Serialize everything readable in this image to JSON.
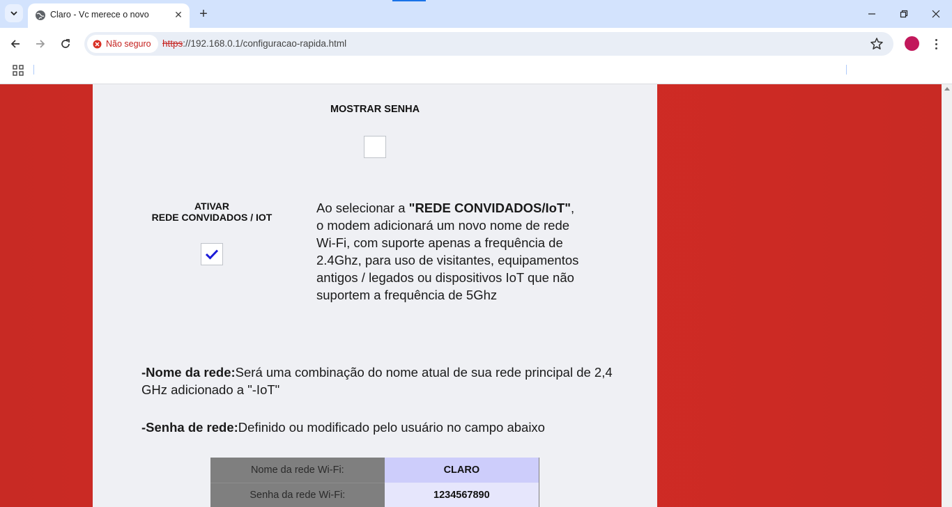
{
  "browser": {
    "tab_title": "Claro - Vc merece o novo",
    "security_chip": "Não seguro",
    "url_scheme": "https",
    "url_rest": "://192.168.0.1/configuracao-rapida.html"
  },
  "page": {
    "show_password_label": "MOSTRAR SENHA",
    "show_password_checked": false,
    "guest_label_line1": "ATIVAR",
    "guest_label_line2": "REDE CONVIDADOS / IOT",
    "guest_checked": true,
    "guest_desc_prefix": "Ao selecionar a ",
    "guest_desc_bold": "\"REDE CONVIDADOS/IoT\"",
    "guest_desc_suffix": ", o modem adicionará um novo nome de rede Wi-Fi, com suporte apenas a frequência de 2.4Ghz, para uso de visitantes, equipamentos antigos / legados ou dispositivos IoT que não suportem a frequência de 5Ghz",
    "network_name_label": "-Nome da rede:",
    "network_name_text": "Será uma combinação do nome atual de sua rede principal de 2,4 GHz adicionado a \"-IoT\"",
    "network_pass_label": "-Senha de rede:",
    "network_pass_text": "Definido ou modificado pelo usuário no campo abaixo",
    "table": [
      {
        "key": "Nome da rede Wi-Fi:",
        "value": "CLARO"
      },
      {
        "key": "Senha da rede Wi-Fi:",
        "value": "1234567890"
      }
    ]
  },
  "colors": {
    "page_red": "#d22b25",
    "panel_bg": "#eff0f4",
    "check_blue": "#1a1ad8"
  }
}
